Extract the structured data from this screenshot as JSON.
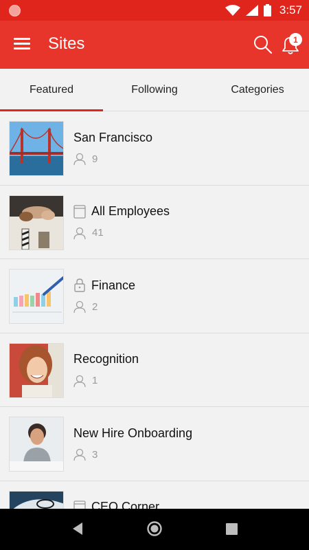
{
  "status_bar": {
    "time": "3:57"
  },
  "app_bar": {
    "title": "Sites",
    "notification_count": "1"
  },
  "tabs": [
    {
      "label": "Featured",
      "active": true
    },
    {
      "label": "Following",
      "active": false
    },
    {
      "label": "Categories",
      "active": false
    }
  ],
  "sites": [
    {
      "name": "San Francisco",
      "members": "9",
      "icon": "none"
    },
    {
      "name": "All Employees",
      "members": "41",
      "icon": "page-icon"
    },
    {
      "name": "Finance",
      "members": "2",
      "icon": "lock-icon"
    },
    {
      "name": "Recognition",
      "members": "1",
      "icon": "none"
    },
    {
      "name": "New Hire Onboarding",
      "members": "3",
      "icon": "none"
    },
    {
      "name": "CEO Corner",
      "members": "",
      "icon": "page-icon"
    }
  ],
  "colors": {
    "primary": "#e8352b",
    "status_bar": "#e0261c",
    "background": "#f2f2f2"
  }
}
